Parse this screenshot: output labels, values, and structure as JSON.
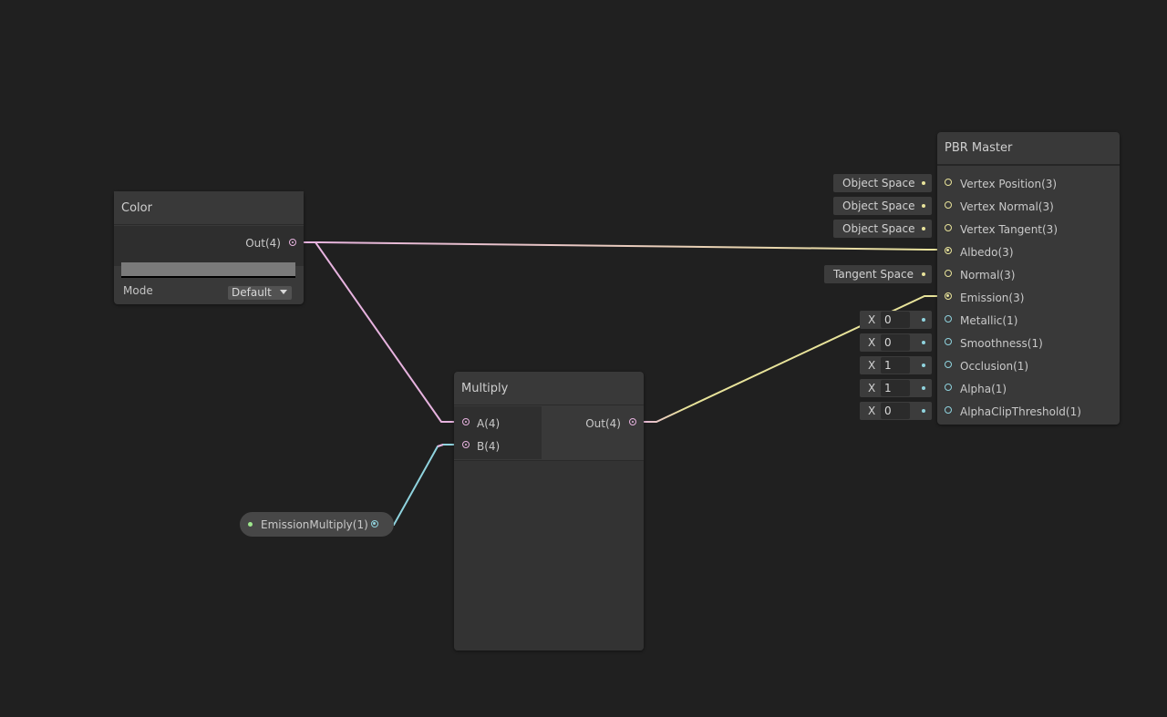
{
  "color_node": {
    "title": "Color",
    "output_label": "Out(4)",
    "swatch_color": "#7a7a7a",
    "mode_label": "Mode",
    "mode_value": "Default"
  },
  "multiply_node": {
    "title": "Multiply",
    "inputs": [
      "A(4)",
      "B(4)"
    ],
    "output_label": "Out(4)"
  },
  "property_node": {
    "label": "EmissionMultiply(1)"
  },
  "pbr_master": {
    "title": "PBR Master",
    "slots": [
      {
        "label": "Vertex Position(3)",
        "inline": "Object Space"
      },
      {
        "label": "Vertex Normal(3)",
        "inline": "Object Space"
      },
      {
        "label": "Vertex Tangent(3)",
        "inline": "Object Space"
      },
      {
        "label": "Albedo(3)",
        "inline": ""
      },
      {
        "label": "Normal(3)",
        "inline": "Tangent Space"
      },
      {
        "label": "Emission(3)",
        "inline": ""
      },
      {
        "label": "Metallic(1)",
        "axis": "X",
        "value": "0"
      },
      {
        "label": "Smoothness(1)",
        "axis": "X",
        "value": "0"
      },
      {
        "label": "Occlusion(1)",
        "axis": "X",
        "value": "1"
      },
      {
        "label": "Alpha(1)",
        "axis": "X",
        "value": "1"
      },
      {
        "label": "AlphaClipThreshold(1)",
        "axis": "X",
        "value": "0"
      }
    ]
  },
  "colors": {
    "background": "#202020",
    "vector4_wire": "#e7b3df",
    "vector3_wire": "#e8e39a",
    "vector1_wire": "#8fd3de",
    "property_dot": "#9ee88d"
  }
}
